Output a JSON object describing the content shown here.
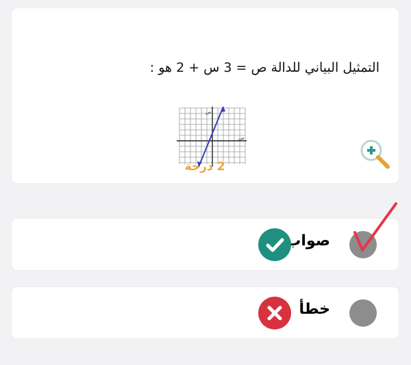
{
  "question": {
    "text": "التمثيل البياني للدالة   ص = 3 س + 2  هو :",
    "grade": "2 درجة",
    "graph_axis_label": "ص",
    "graph_x_label": "س"
  },
  "options": [
    {
      "label": "صواب",
      "indicator": "check-icon",
      "color": "#1f8f80"
    },
    {
      "label": "خطأ",
      "indicator": "x-icon",
      "color": "#d8323e"
    }
  ]
}
